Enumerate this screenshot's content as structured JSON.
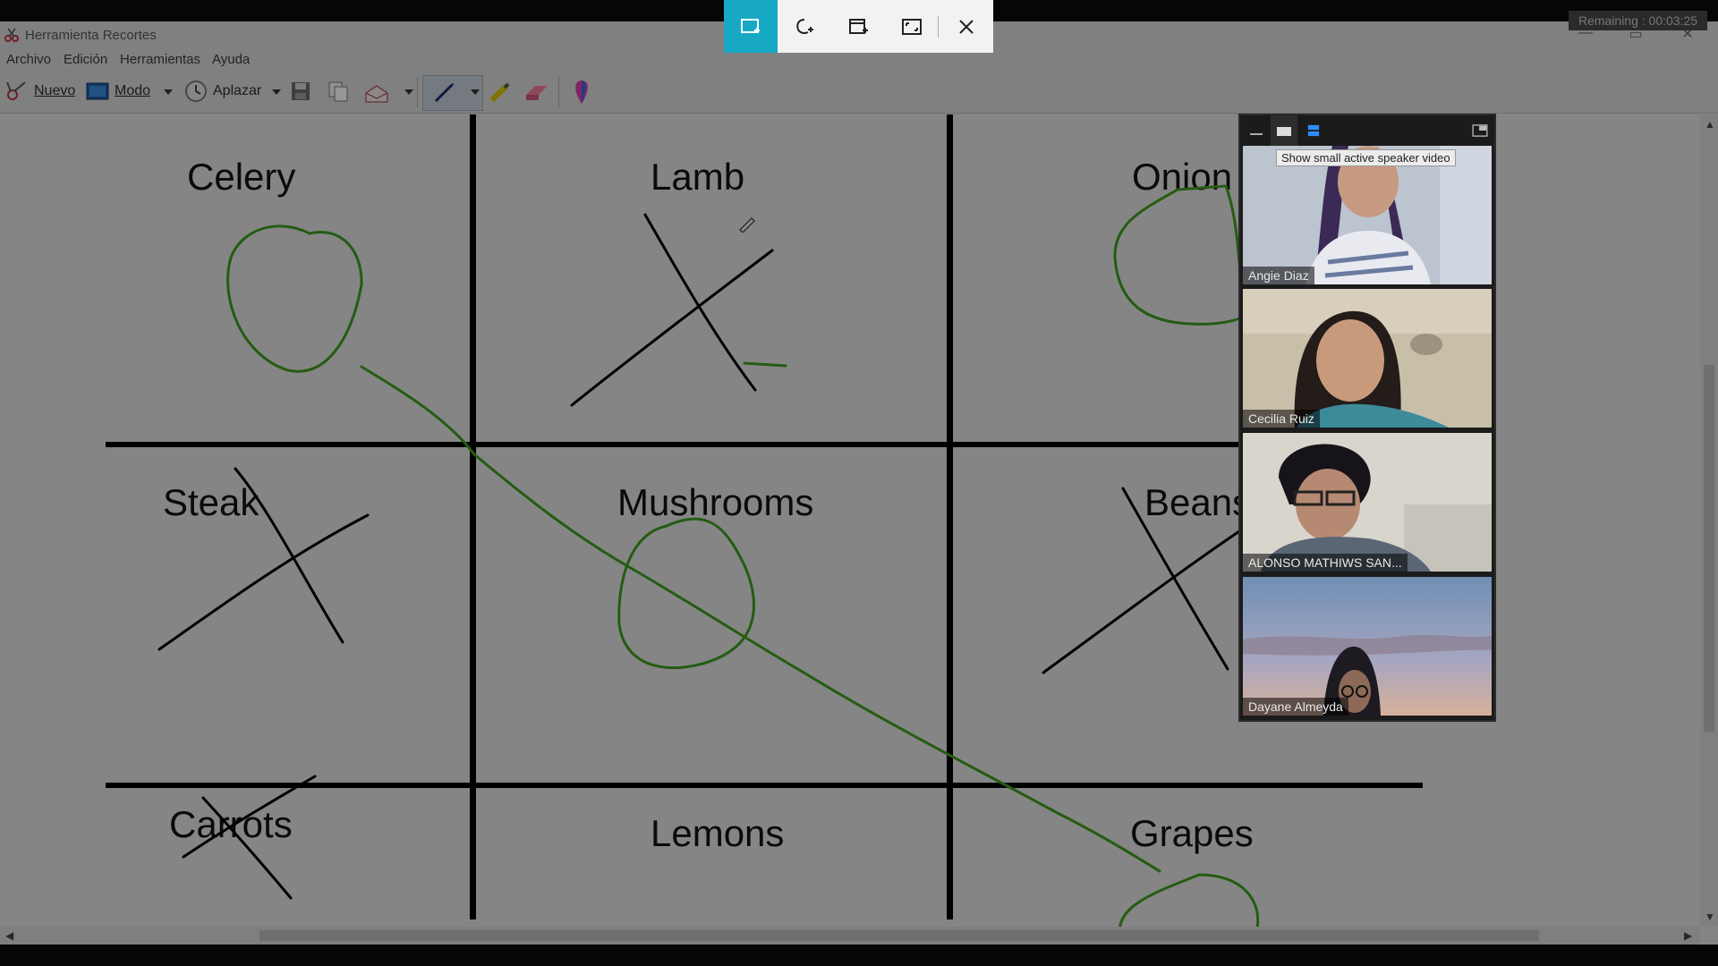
{
  "snip_toolbar": {
    "modes": [
      "rectangular-snip-icon",
      "freeform-snip-icon",
      "window-snip-icon",
      "fullscreen-snip-icon",
      "close-icon"
    ],
    "active_color": "#17a9c4"
  },
  "timer": {
    "text": "Remaining : 00:03:25"
  },
  "window": {
    "title": "Herramienta Recortes"
  },
  "menu": {
    "items": [
      "Archivo",
      "Edición",
      "Herramientas",
      "Ayuda"
    ]
  },
  "toolbar": {
    "new_label": "Nuevo",
    "mode_label": "Modo",
    "delay_label": "Aplazar"
  },
  "board": {
    "cells": [
      "Celery",
      "Lamb",
      "Onion",
      "Steak",
      "Mushrooms",
      "Beans",
      "Carrots",
      "Lemons",
      "Grapes"
    ],
    "ink_green": "#3c9a1e",
    "ink_black": "#000000"
  },
  "video_panel": {
    "tooltip": "Show small active speaker video",
    "participants": [
      "Angie Diaz",
      "Cecilia Ruiz",
      "ALONSO MATHIWS SAN...",
      "Dayane Almeyda"
    ]
  }
}
